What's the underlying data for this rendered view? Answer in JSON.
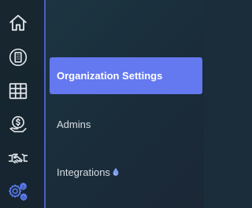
{
  "rail": {
    "items": [
      {
        "icon": "home-icon",
        "active": false
      },
      {
        "icon": "building-icon",
        "active": false
      },
      {
        "icon": "table-icon",
        "active": false
      },
      {
        "icon": "money-hand-icon",
        "active": false
      },
      {
        "icon": "handshake-icon",
        "active": false
      },
      {
        "icon": "gears-icon",
        "active": true
      }
    ]
  },
  "menu": {
    "items": [
      {
        "label": "Organization Settings",
        "active": true
      },
      {
        "label": "Admins",
        "active": false
      },
      {
        "label": "Integrations",
        "active": false,
        "badge_icon": "droplet-icon"
      }
    ]
  },
  "colors": {
    "rail_bg": "#17262f",
    "panel_bg": "#1b2d3a",
    "accent": "#6478f0",
    "icon_default": "#e2e6ea",
    "icon_active": "#5b7cf0",
    "divider": "#4a5fc4"
  }
}
